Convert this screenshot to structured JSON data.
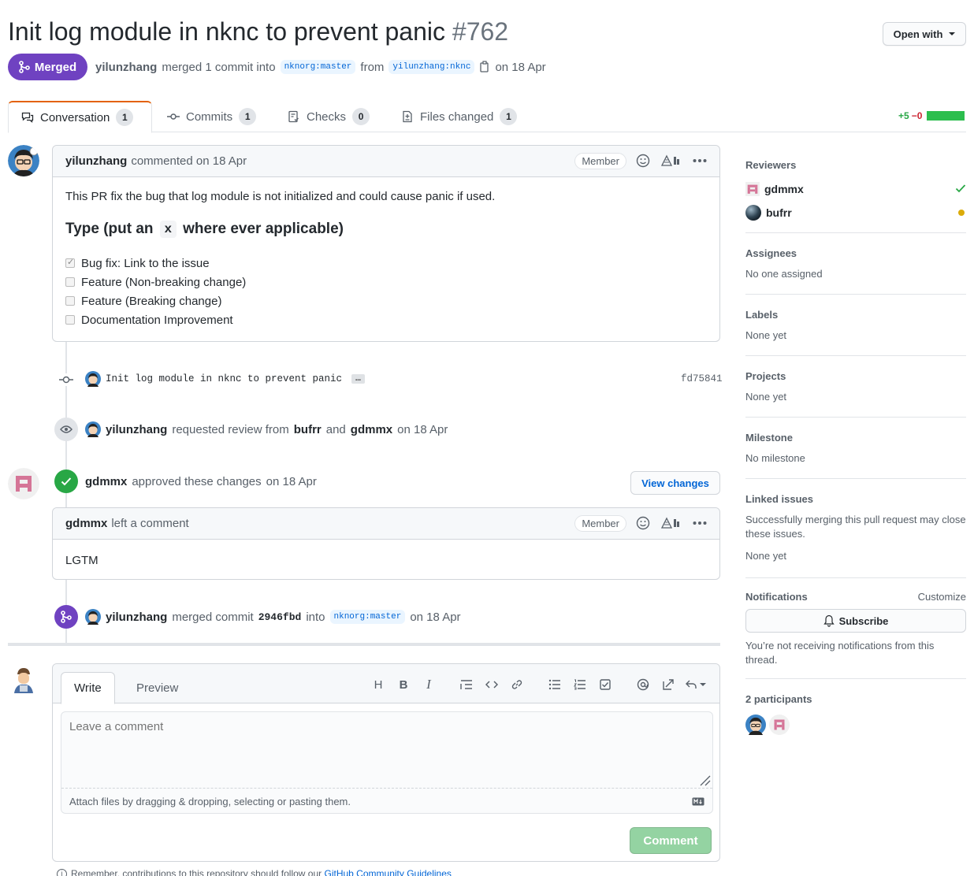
{
  "header": {
    "title": "Init log module in nknc to prevent panic",
    "number": "#762",
    "open_with": "Open with",
    "state_badge": "Merged",
    "meta": {
      "author": "yilunzhang",
      "action": "merged 1 commit into",
      "base_branch": "nknorg:master",
      "from": "from",
      "head_branch": "yilunzhang:nknc",
      "date": "on 18 Apr"
    }
  },
  "tabs": [
    {
      "label": "Conversation",
      "count": "1"
    },
    {
      "label": "Commits",
      "count": "1"
    },
    {
      "label": "Checks",
      "count": "0"
    },
    {
      "label": "Files changed",
      "count": "1"
    }
  ],
  "diffstat": {
    "added": "+5",
    "removed": "−0"
  },
  "first_comment": {
    "author": "yilunzhang",
    "action": "commented on 18 Apr",
    "role": "Member",
    "body": "This PR fix the bug that log module is not initialized and could cause panic if used.",
    "heading_before": "Type (put an",
    "heading_code": "x",
    "heading_after": "where ever applicable)",
    "tasks": [
      {
        "label": "Bug fix: Link to the issue",
        "checked": true
      },
      {
        "label": "Feature (Non-breaking change)",
        "checked": false
      },
      {
        "label": "Feature (Breaking change)",
        "checked": false
      },
      {
        "label": "Documentation Improvement",
        "checked": false
      }
    ]
  },
  "commit_event": {
    "message": "Init log module in nknc to prevent panic",
    "ellipsis": "…",
    "sha": "fd75841"
  },
  "review_request": {
    "actor": "yilunzhang",
    "text": "requested review from",
    "reviewer1": "bufrr",
    "and": "and",
    "reviewer2": "gdmmx",
    "date": "on 18 Apr"
  },
  "approval": {
    "actor": "gdmmx",
    "text": "approved these changes",
    "date": "on 18 Apr",
    "view_changes": "View changes"
  },
  "second_comment": {
    "author": "gdmmx",
    "action": "left a comment",
    "role": "Member",
    "body": "LGTM"
  },
  "merge_event": {
    "actor": "yilunzhang",
    "text": "merged commit",
    "sha": "2946fbd",
    "into": "into",
    "branch": "nknorg:master",
    "date": "on 18 Apr"
  },
  "composer": {
    "write_tab": "Write",
    "preview_tab": "Preview",
    "placeholder": "Leave a comment",
    "attach_hint": "Attach files by dragging & dropping, selecting or pasting them.",
    "submit": "Comment",
    "footer_prefix": "Remember, contributions to this repository should follow our",
    "footer_link": "GitHub Community Guidelines"
  },
  "sidebar": {
    "reviewers_title": "Reviewers",
    "reviewers": [
      {
        "name": "gdmmx",
        "status": "approved"
      },
      {
        "name": "bufrr",
        "status": "pending"
      }
    ],
    "assignees_title": "Assignees",
    "assignees_value": "No one assigned",
    "labels_title": "Labels",
    "labels_value": "None yet",
    "projects_title": "Projects",
    "projects_value": "None yet",
    "milestone_title": "Milestone",
    "milestone_value": "No milestone",
    "linked_title": "Linked issues",
    "linked_desc": "Successfully merging this pull request may close these issues.",
    "linked_value": "None yet",
    "notifications_title": "Notifications",
    "customize": "Customize",
    "subscribe": "Subscribe",
    "notif_desc": "You’re not receiving notifications from this thread.",
    "participants_title": "2 participants"
  },
  "colors": {
    "merged": "#6f42c1",
    "approved": "#28a745",
    "link": "#0366d6",
    "pending": "#dbab09"
  }
}
